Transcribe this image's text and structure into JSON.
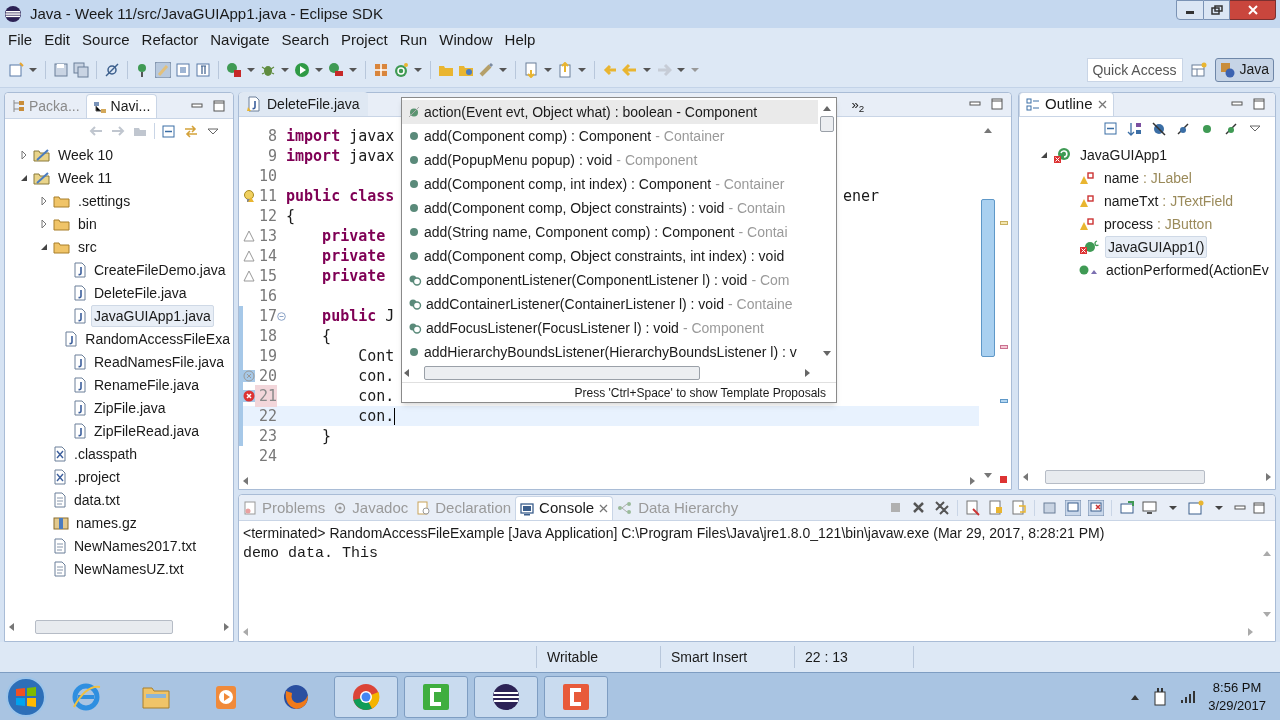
{
  "window": {
    "title": "Java - Week 11/src/JavaGUIApp1.java - Eclipse SDK"
  },
  "menu": [
    "File",
    "Edit",
    "Source",
    "Refactor",
    "Navigate",
    "Search",
    "Project",
    "Run",
    "Window",
    "Help"
  ],
  "quick_access": {
    "placeholder": "Quick Access"
  },
  "perspective": {
    "label": "Java",
    "selected": true
  },
  "left_panel": {
    "tabs": [
      {
        "label": "Packa...",
        "selected": false
      },
      {
        "label": "Navi...",
        "selected": true
      }
    ],
    "tree": [
      {
        "label": "Week 10",
        "kind": "project",
        "expanded": false,
        "selected": false
      },
      {
        "label": "Week 11",
        "kind": "project",
        "expanded": true,
        "selected": false,
        "children": [
          {
            "label": ".settings",
            "kind": "folder",
            "expanded": false,
            "selected": false
          },
          {
            "label": "bin",
            "kind": "folder",
            "expanded": false,
            "selected": false
          },
          {
            "label": "src",
            "kind": "folder",
            "expanded": true,
            "selected": false,
            "children": [
              {
                "label": "CreateFileDemo.java",
                "kind": "java",
                "selected": false
              },
              {
                "label": "DeleteFile.java",
                "kind": "java",
                "selected": false
              },
              {
                "label": "JavaGUIApp1.java",
                "kind": "java",
                "selected": true
              },
              {
                "label": "RandomAccessFileExa",
                "kind": "java",
                "selected": false
              },
              {
                "label": "ReadNamesFile.java",
                "kind": "java",
                "selected": false
              },
              {
                "label": "RenameFile.java",
                "kind": "java",
                "selected": false
              },
              {
                "label": "ZipFile.java",
                "kind": "java",
                "selected": false
              },
              {
                "label": "ZipFileRead.java",
                "kind": "java",
                "selected": false
              }
            ]
          },
          {
            "label": ".classpath",
            "kind": "xml",
            "selected": false
          },
          {
            "label": ".project",
            "kind": "xml",
            "selected": false
          },
          {
            "label": "data.txt",
            "kind": "text",
            "selected": false
          },
          {
            "label": "names.gz",
            "kind": "archive",
            "selected": false
          },
          {
            "label": "NewNames2017.txt",
            "kind": "text",
            "selected": false
          },
          {
            "label": "NewNamesUZ.txt",
            "kind": "text",
            "selected": false
          }
        ]
      }
    ]
  },
  "editor": {
    "tabs": [
      {
        "label": "DeleteFile.java",
        "selected": false
      }
    ],
    "overflow": "»$_{2}$",
    "lines": [
      {
        "number": "8",
        "kind": "plain",
        "tokens": [
          {
            "text": "import",
            "kind": "keyword"
          },
          {
            "text": " javax",
            "kind": "plain"
          }
        ]
      },
      {
        "number": "9",
        "kind": "plain",
        "tokens": [
          {
            "text": "import",
            "kind": "keyword"
          },
          {
            "text": " javax",
            "kind": "plain"
          }
        ]
      },
      {
        "number": "10",
        "kind": "plain"
      },
      {
        "number": "11",
        "kind": "bulb",
        "tokens": [
          {
            "text": "public class",
            "kind": "keyword"
          },
          {
            "text": "ener",
            "kind": "tail"
          }
        ]
      },
      {
        "number": "12",
        "kind": "plain",
        "tokens": [
          {
            "text": "{",
            "kind": "plain"
          }
        ]
      },
      {
        "number": "13",
        "kind": "warning",
        "tokens": [
          {
            "text": "    private",
            "kind": "keyword"
          }
        ]
      },
      {
        "number": "14",
        "kind": "warning",
        "tokens": [
          {
            "text": "    private",
            "kind": "keyword"
          }
        ]
      },
      {
        "number": "15",
        "kind": "warning",
        "tokens": [
          {
            "text": "    private",
            "kind": "keyword"
          }
        ]
      },
      {
        "number": "16",
        "kind": "plain"
      },
      {
        "number": "17",
        "kind": "plain",
        "changed": true,
        "fold": true,
        "tokens": [
          {
            "text": "    public",
            "kind": "keyword"
          },
          {
            "text": " J",
            "kind": "plain"
          }
        ]
      },
      {
        "number": "18",
        "kind": "plain",
        "changed": true,
        "tokens": [
          {
            "text": "    {",
            "kind": "plain"
          }
        ]
      },
      {
        "number": "19",
        "kind": "plain",
        "changed": true,
        "tokens": [
          {
            "text": "        Cont",
            "kind": "plain"
          }
        ]
      },
      {
        "number": "20",
        "kind": "error-faded",
        "changed": true,
        "tokens": [
          {
            "text": "        con.",
            "kind": "plain"
          }
        ]
      },
      {
        "number": "21",
        "kind": "error",
        "changed": true,
        "tokens": [
          {
            "text": "        con.",
            "kind": "plain"
          }
        ]
      },
      {
        "number": "22",
        "kind": "plain",
        "changed": true,
        "current": true,
        "tokens": [
          {
            "text": "        con.",
            "kind": "plain"
          }
        ]
      },
      {
        "number": "23",
        "kind": "plain",
        "changed": true,
        "tokens": [
          {
            "text": "    }",
            "kind": "plain"
          }
        ]
      },
      {
        "number": "24",
        "kind": "plain"
      }
    ],
    "proposals": [
      {
        "signature": "action(Event evt, Object what) : boolean",
        "owner": "- Component",
        "kind": "deprecated",
        "selected": true
      },
      {
        "signature": "add(Component comp) : Component",
        "owner": "- Container",
        "kind": "method",
        "selected": false
      },
      {
        "signature": "add(PopupMenu popup) : void",
        "owner": "- Component",
        "kind": "method",
        "selected": false
      },
      {
        "signature": "add(Component comp, int index) : Component",
        "owner": "- Container",
        "kind": "method",
        "selected": false
      },
      {
        "signature": "add(Component comp, Object constraints) : void",
        "owner": "- Contain",
        "kind": "method",
        "selected": false
      },
      {
        "signature": "add(String name, Component comp) : Component",
        "owner": "- Contai",
        "kind": "method",
        "selected": false
      },
      {
        "signature": "add(Component comp, Object constraints, int index) : void",
        "kind": "method",
        "selected": false
      },
      {
        "signature": "addComponentListener(ComponentListener l) : void",
        "owner": "- Com",
        "kind": "listener",
        "selected": false
      },
      {
        "signature": "addContainerListener(ContainerListener l) : void",
        "owner": "- Containe",
        "kind": "listener",
        "selected": false
      },
      {
        "signature": "addFocusListener(FocusListener l) : void",
        "owner": "- Component",
        "kind": "listener",
        "selected": false
      },
      {
        "signature": "addHierarchyBoundsListener(HierarchyBoundsListener l) : v",
        "kind": "method",
        "selected": false
      }
    ],
    "proposals_hint": "Press 'Ctrl+Space' to show Template Proposals"
  },
  "outline": {
    "tabs": [
      {
        "label": "Outline",
        "selected": true
      }
    ],
    "tree": [
      {
        "label": "JavaGUIApp1",
        "kind": "class",
        "expanded": true,
        "selected": false,
        "children": [
          {
            "label": "name",
            "type": ": JLabel",
            "kind": "field",
            "selected": false
          },
          {
            "label": "nameTxt",
            "type": ": JTextField",
            "kind": "field",
            "selected": false
          },
          {
            "label": "process",
            "type": ": JButton",
            "kind": "field",
            "selected": false
          },
          {
            "label": "JavaGUIApp1()",
            "kind": "constructor",
            "selected": true
          },
          {
            "label": "actionPerformed(ActionEv",
            "kind": "method",
            "selected": false
          }
        ]
      }
    ]
  },
  "console": {
    "tabs": [
      {
        "label": "Problems",
        "selected": false
      },
      {
        "label": "Javadoc",
        "selected": false
      },
      {
        "label": "Declaration",
        "selected": false
      },
      {
        "label": "Console",
        "selected": true
      },
      {
        "label": "Data Hierarchy",
        "selected": false
      }
    ],
    "header": "<terminated> RandomAccessFileExample [Java Application] C:\\Program Files\\Java\\jre1.8.0_121\\bin\\javaw.exe (Mar 29, 2017, 8:28:21 PM)",
    "output": "demo data. This"
  },
  "status_bar": [
    "Writable",
    "Smart Insert",
    "22 : 13"
  ],
  "taskbar": {
    "apps": [
      {
        "kind": "ie",
        "active": false
      },
      {
        "kind": "explorer",
        "active": false
      },
      {
        "kind": "media",
        "active": false
      },
      {
        "kind": "firefox",
        "active": false
      },
      {
        "kind": "chrome",
        "active": true
      },
      {
        "kind": "camtasia-green",
        "active": true
      },
      {
        "kind": "eclipse",
        "active": true
      },
      {
        "kind": "camtasia-orange",
        "active": true
      }
    ],
    "time": "8:56 PM",
    "date": "3/29/2017"
  }
}
